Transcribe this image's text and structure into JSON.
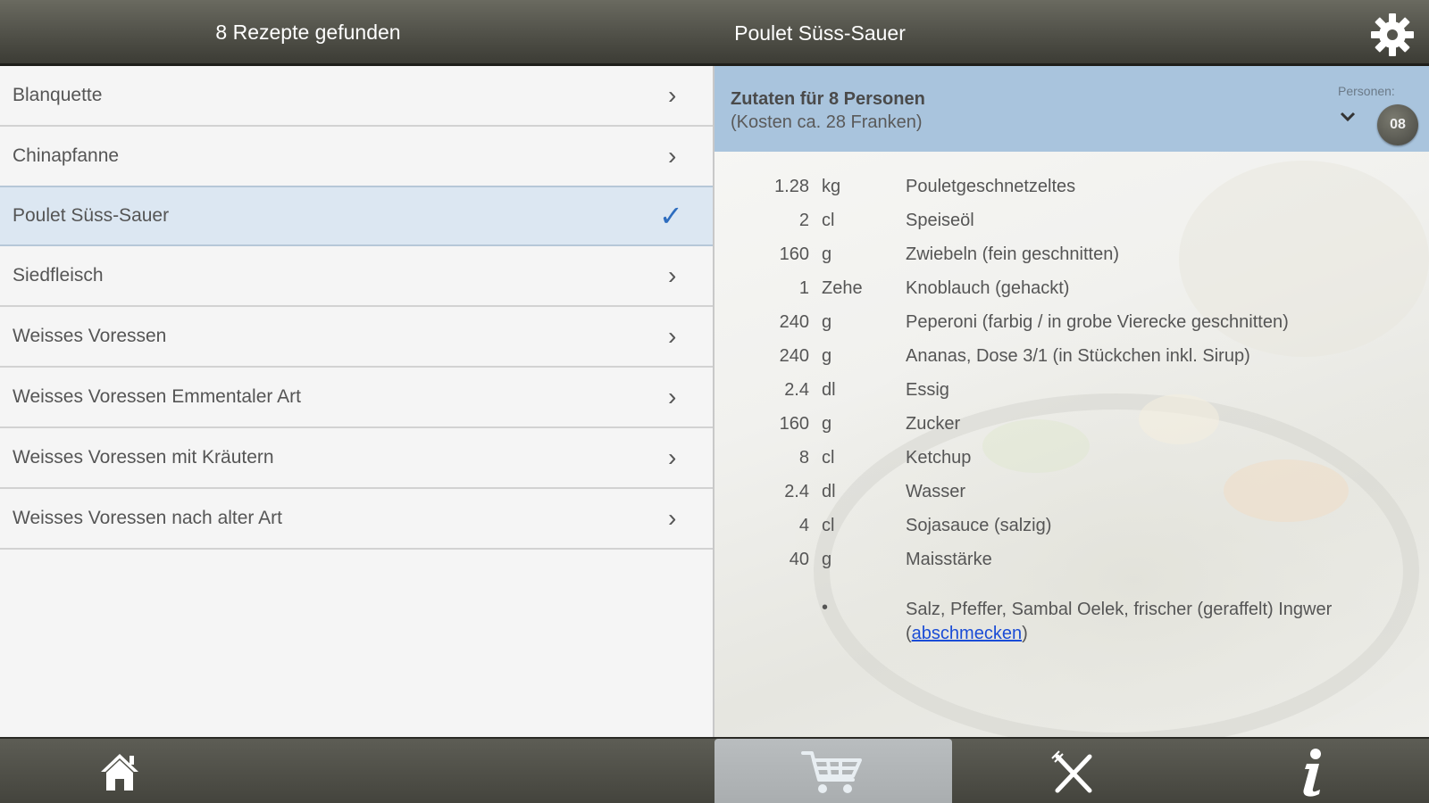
{
  "header": {
    "results_title": "8 Rezepte gefunden",
    "recipe_title": "Poulet Süss-Sauer"
  },
  "recipes": [
    {
      "label": "Blanquette",
      "selected": false
    },
    {
      "label": "Chinapfanne",
      "selected": false
    },
    {
      "label": "Poulet Süss-Sauer",
      "selected": true
    },
    {
      "label": "Siedfleisch",
      "selected": false
    },
    {
      "label": "Weisses Voressen",
      "selected": false
    },
    {
      "label": "Weisses Voressen Emmentaler Art",
      "selected": false
    },
    {
      "label": "Weisses Voressen mit Kräutern",
      "selected": false
    },
    {
      "label": "Weisses Voressen nach alter Art",
      "selected": false
    }
  ],
  "ingredients_header": {
    "title": "Zutaten für 8 Personen",
    "cost": "(Kosten ca. 28 Franken)",
    "persons_label": "Personen:",
    "persons_value": "08"
  },
  "ingredients": [
    {
      "qty": "1.28",
      "unit": "kg",
      "name": "Pouletgeschnetzeltes"
    },
    {
      "qty": "2",
      "unit": "cl",
      "name": "Speiseöl"
    },
    {
      "qty": "160",
      "unit": "g",
      "name": "Zwiebeln (fein geschnitten)"
    },
    {
      "qty": "1",
      "unit": "Zehe",
      "name": "Knoblauch (gehackt)"
    },
    {
      "qty": "240",
      "unit": "g",
      "name": "Peperoni (farbig / in grobe Vierecke geschnitten)"
    },
    {
      "qty": "240",
      "unit": "g",
      "name": "Ananas, Dose 3/1 (in Stückchen inkl. Sirup)"
    },
    {
      "qty": "2.4",
      "unit": "dl",
      "name": "Essig"
    },
    {
      "qty": "160",
      "unit": "g",
      "name": "Zucker"
    },
    {
      "qty": "8",
      "unit": "cl",
      "name": "Ketchup"
    },
    {
      "qty": "2.4",
      "unit": "dl",
      "name": "Wasser"
    },
    {
      "qty": "4",
      "unit": "cl",
      "name": "Sojasauce (salzig)"
    },
    {
      "qty": "40",
      "unit": "g",
      "name": "Maisstärke"
    }
  ],
  "seasoning": {
    "bullet": "•",
    "text_before": "Salz, Pfeffer, Sambal Oelek, frischer (geraffelt) Ingwer (",
    "link": "abschmecken",
    "text_after": ")"
  },
  "icons": {
    "settings": "gear-icon",
    "home": "home-icon",
    "cart": "cart-icon",
    "cutlery": "fork-knife-icon",
    "info": "info-icon"
  },
  "colors": {
    "selected_row": "#dce7f2",
    "check": "#2e6dbf",
    "header_band": "#a9c4dd",
    "link": "#1a4cd6"
  }
}
